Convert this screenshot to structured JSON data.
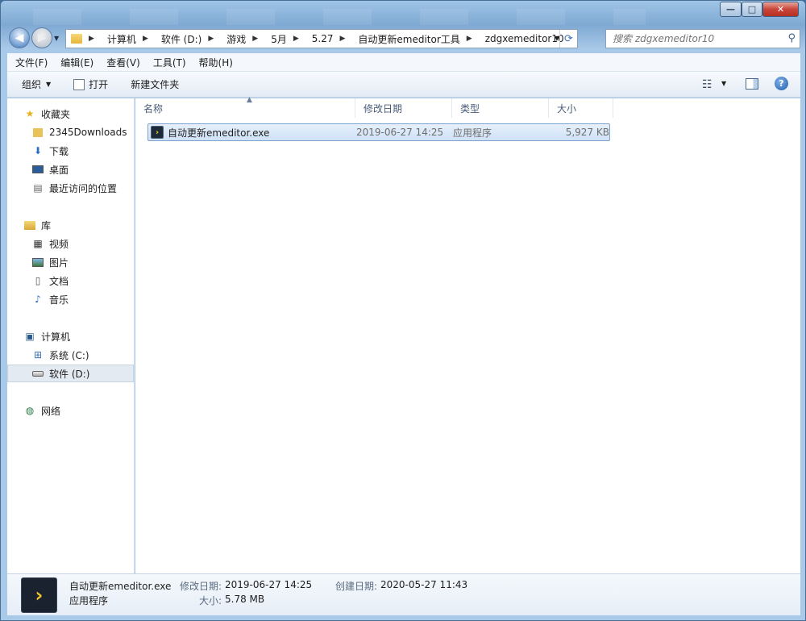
{
  "window": {
    "min_label": "—",
    "max_label": "□",
    "close_label": "✕"
  },
  "nav": {
    "back_icon": "◀",
    "forward_icon": "▶",
    "breadcrumbs": [
      "计算机",
      "软件 (D:)",
      "游戏",
      "5月",
      "5.27",
      "自动更新emeditor工具",
      "zdgxemeditor10"
    ],
    "search_placeholder": "搜索 zdgxemeditor10"
  },
  "menu": [
    "文件(F)",
    "编辑(E)",
    "查看(V)",
    "工具(T)",
    "帮助(H)"
  ],
  "toolbar": {
    "organize": "组织",
    "open": "打开",
    "new_folder": "新建文件夹"
  },
  "sidebar": {
    "favorites": {
      "label": "收藏夹",
      "items": [
        "2345Downloads",
        "下载",
        "桌面",
        "最近访问的位置"
      ]
    },
    "libraries": {
      "label": "库",
      "items": [
        "视频",
        "图片",
        "文档",
        "音乐"
      ]
    },
    "computer": {
      "label": "计算机",
      "items": [
        "系统 (C:)",
        "软件 (D:)"
      ]
    },
    "network": {
      "label": "网络"
    }
  },
  "columns": [
    "名称",
    "修改日期",
    "类型",
    "大小"
  ],
  "files": [
    {
      "name": "自动更新emeditor.exe",
      "date": "2019-06-27 14:25",
      "type": "应用程序",
      "size": "5,927 KB"
    }
  ],
  "details": {
    "filename": "自动更新emeditor.exe",
    "type": "应用程序",
    "modified_label": "修改日期:",
    "modified": "2019-06-27 14:25",
    "created_label": "创建日期:",
    "created": "2020-05-27 11:43",
    "size_label": "大小:",
    "size": "5.78 MB"
  }
}
